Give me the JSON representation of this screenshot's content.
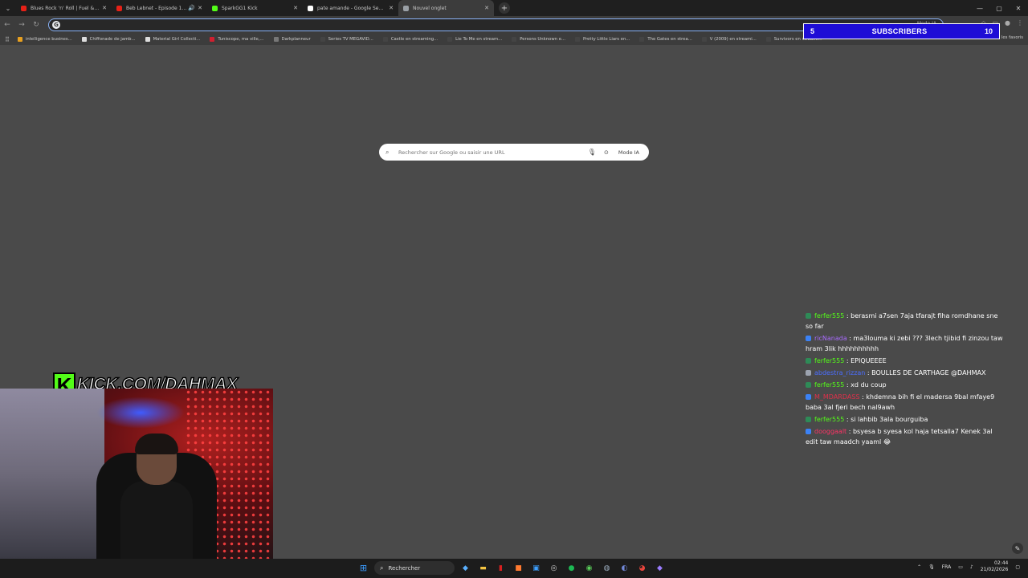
{
  "tabs": [
    {
      "title": "Blues Rock 'n' Roll | Fuel & Fire",
      "favicon_color": "#e62117",
      "active": false,
      "audio": false
    },
    {
      "title": "Beb Lebnet - Episode 1 | 1",
      "favicon_color": "#e62117",
      "active": false,
      "audio": true
    },
    {
      "title": "SparkGG1 Kick",
      "favicon_color": "#53fc18",
      "active": false,
      "audio": false
    },
    {
      "title": "pate amande - Google Search",
      "favicon_color": "#ffffff",
      "active": false,
      "audio": false
    },
    {
      "title": "Nouvel onglet",
      "favicon_color": "#9aa0a6",
      "active": true,
      "audio": false
    }
  ],
  "omnibox": {
    "value": "",
    "mode_label": "Mode IA"
  },
  "bookmarks": [
    "intelligence busines...",
    "Chiffonade de jamb...",
    "Material Girl Collecti...",
    "Tuniscope, ma ville,...",
    "Darkplanneur",
    "Series TV MEGAVID...",
    "Castle en streaming...",
    "Lie To Me en stream...",
    "Persons Unknown e...",
    "Pretty Little Liars en...",
    "The Gates en strea...",
    "V (2009) en streami...",
    "Survivors en streami..."
  ],
  "bookmarks_all": "Tous les favoris",
  "subscribers": {
    "count_left": "5",
    "label": "SUBSCRIBERS",
    "count_right": "10"
  },
  "search": {
    "placeholder": "Rechercher sur Google ou saisir une URL",
    "mode_label": "Mode IA"
  },
  "chat": [
    {
      "user": "ferfer555",
      "user_color": "#53fc18",
      "badge_color": "#2e8b57",
      "text": "berasmi a7sen 7aja tfarajt fiha romdhane sne so far"
    },
    {
      "user": "ricNanada",
      "user_color": "#a96bff",
      "badge_color": "#3b82f6",
      "text": "ma3louma ki zebi ??? 3lech tjibid fi zinzou taw hram 3lik hhhhhhhhhh"
    },
    {
      "user": "ferfer555",
      "user_color": "#53fc18",
      "badge_color": "#2e8b57",
      "text": "EPIQUEEEE"
    },
    {
      "user": "abdestra_rizzan",
      "user_color": "#4a6dff",
      "badge_color": "#9ca3af",
      "text": "BOULLES DE CARTHAGE @DAHMAX"
    },
    {
      "user": "ferfer555",
      "user_color": "#53fc18",
      "badge_color": "#2e8b57",
      "text": "xd du coup"
    },
    {
      "user": "M_MDARDASS",
      "user_color": "#e0304a",
      "badge_color": "#3b82f6",
      "text": "khdemna bih fi el madersa 9bal mfaye9 baba 3al fjeri bech nal9awh"
    },
    {
      "user": "ferfer555",
      "user_color": "#53fc18",
      "badge_color": "#2e8b57",
      "text": "si lahbib 3ala bourguiba"
    },
    {
      "user": "dooggaalt",
      "user_color": "#ff3366",
      "badge_color": "#3b82f6",
      "text": "bsyesa b syesa kol haja tetsalla7 Kenek 3al edit taw maadch yaaml 😂"
    }
  ],
  "overlay": {
    "brand_letter": "K",
    "brand_text": "KICK.COM/DAHMAX",
    "brand_color": "#53fc18"
  },
  "taskbar": {
    "search_label": "Rechercher",
    "lang": "FRA",
    "time": "02:44",
    "date": "21/02/2026"
  }
}
